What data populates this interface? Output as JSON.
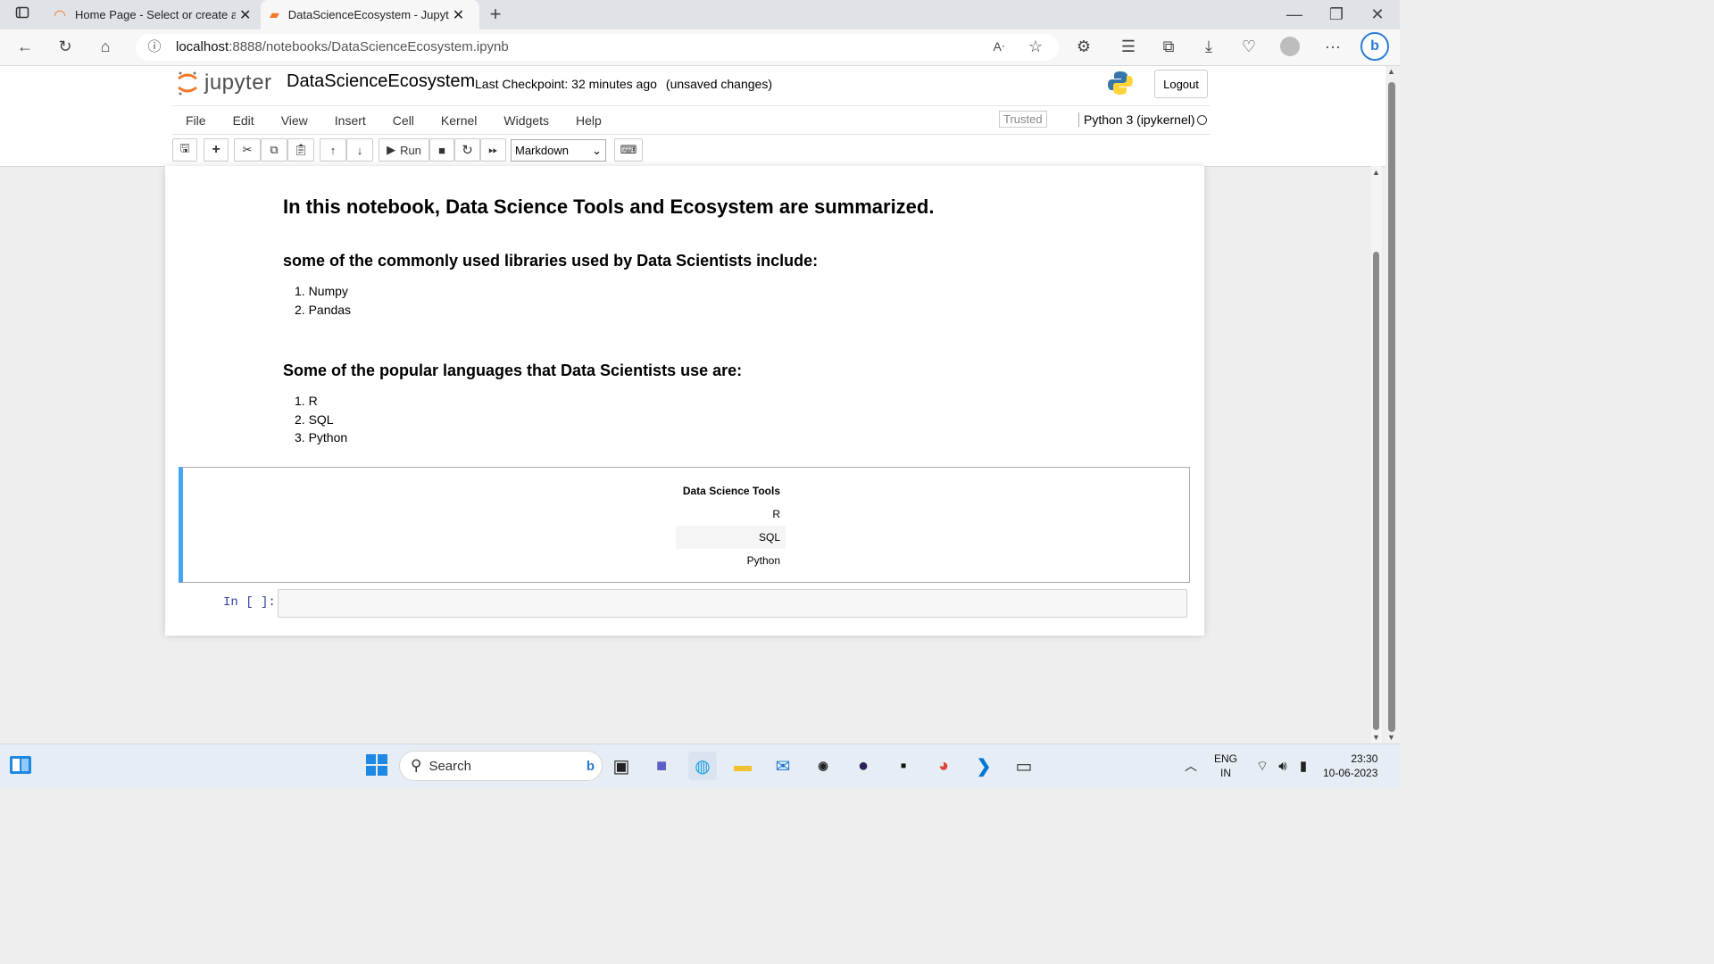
{
  "browser": {
    "tabs": [
      {
        "title": "Home Page - Select or create a n"
      },
      {
        "title": "DataScienceEcosystem - Jupyter"
      }
    ],
    "url_host": "localhost",
    "url_rest": ":8888/notebooks/DataScienceEcosystem.ipynb"
  },
  "jupyter": {
    "logo_text": "jupyter",
    "notebook_title": "DataScienceEcosystem",
    "checkpoint": "Last Checkpoint: 32 minutes ago",
    "unsaved": "(unsaved changes)",
    "logout": "Logout",
    "menus": [
      "File",
      "Edit",
      "View",
      "Insert",
      "Cell",
      "Kernel",
      "Widgets",
      "Help"
    ],
    "trusted": "Trusted",
    "kernel": "Python 3 (ipykernel)",
    "toolbar": {
      "run_label": "Run",
      "cell_type": "Markdown"
    }
  },
  "notebook": {
    "heading1": "In this notebook, Data Science Tools and Ecosystem are summarized.",
    "libs_heading": "some of the commonly used libraries used by Data Scientists include:",
    "libs": [
      "Numpy",
      "Pandas"
    ],
    "langs_heading": "Some of the popular languages that Data Scientists use are:",
    "langs": [
      "R",
      "SQL",
      "Python"
    ],
    "table": {
      "header": "Data Science Tools",
      "rows": [
        "R",
        "SQL",
        "Python"
      ]
    },
    "prompt": "In [ ]:"
  },
  "taskbar": {
    "search": "Search",
    "lang": [
      "ENG",
      "IN"
    ],
    "time": "23:30",
    "date": "10-06-2023"
  },
  "colors": {
    "selected_cell_border": "#42a5f5",
    "jupyter_orange": "#f37726"
  }
}
